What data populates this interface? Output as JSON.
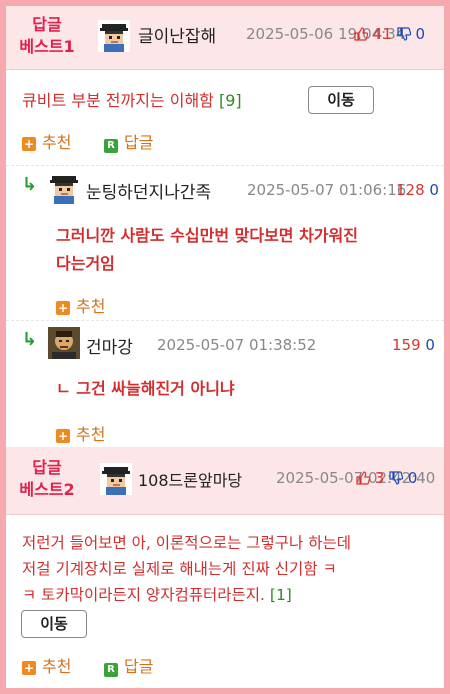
{
  "best1": {
    "label_line1": "답글",
    "label_line2": "베스트1",
    "nick": "글이난잡해",
    "date": "2025-05-06 19:04:34",
    "up": "41",
    "down": "0",
    "body": "큐비트 부분 전까지는 이해함",
    "count": "[9]",
    "move_label": "이동",
    "recommend_label": "추천",
    "reply_label": "답글"
  },
  "replies": [
    {
      "nick": "눈팅하던지나간족",
      "date": "2025-05-07 01:06:16",
      "up": "128",
      "down": "0",
      "body_line1": "그러니깐 사람도 수십만번 맞다보면 차가워진",
      "body_line2": "다는거임",
      "recommend_label": "추천"
    },
    {
      "nick": "건마강",
      "date": "2025-05-07 01:38:52",
      "up": "159",
      "down": "0",
      "body_line1": "ㄴ 그건 싸늘해진거 아니냐",
      "recommend_label": "추천"
    }
  ],
  "best2": {
    "label_line1": "답글",
    "label_line2": "베스트2",
    "nick": "108드론앞마당",
    "date": "2025-05-07 02:42:40",
    "up": "3",
    "down": "0",
    "body_line1": "저런거 들어보면 아, 이론적으로는 그렇구나 하는데",
    "body_line2": "저걸 기계장치로 실제로 해내는게 진짜 신기함 ㅋ",
    "body_line3": "ㅋ 토카막이라든지 양자컴퓨터라든지.",
    "count": "[1]",
    "move_label": "이동",
    "recommend_label": "추천",
    "reply_label": "답글"
  },
  "icons": {
    "reply_arrow": "reply-arrow-icon",
    "thumb_up": "thumb-up-icon",
    "thumb_down": "thumb-down-icon",
    "plus": "plus-icon",
    "reply_badge": "reply-badge-icon"
  },
  "colors": {
    "frame_border": "#f6aab0",
    "best_bg": "#fde6e8",
    "best_label": "#e0204d",
    "body_text": "#d12e2e",
    "count": "#2e8b1e",
    "like_up": "#d8362f",
    "like_down": "#1b49b5",
    "action": "#d4731c"
  }
}
